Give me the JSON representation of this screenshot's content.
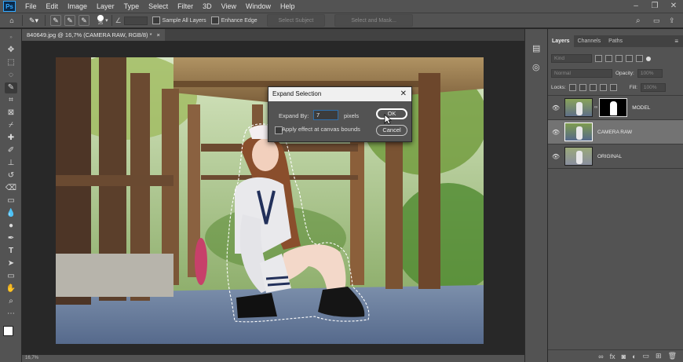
{
  "menubar": {
    "logo": "Ps",
    "items": [
      "File",
      "Edit",
      "Image",
      "Layer",
      "Type",
      "Select",
      "Filter",
      "3D",
      "View",
      "Window",
      "Help"
    ]
  },
  "options": {
    "brush_size": "25",
    "sample_all_layers": "Sample All Layers",
    "enhance_edge": "Enhance Edge",
    "select_subject": "Select Subject",
    "select_and_mask": "Select and Mask..."
  },
  "document": {
    "tab_title": "840649.jpg @ 16,7% (CAMERA RAW, RGB/8) *",
    "tab_close": "×"
  },
  "dialog": {
    "title": "Expand Selection",
    "expand_label": "Expand By:",
    "expand_value": "7",
    "unit": "pixels",
    "apply_bounds": "Apply effect at canvas bounds",
    "ok": "OK",
    "cancel": "Cancel"
  },
  "layers_panel": {
    "tabs": [
      "Layers",
      "Channels",
      "Paths"
    ],
    "kind_placeholder": "Kind",
    "blend_mode": "Normal",
    "opacity_label": "Opacity:",
    "opacity_value": "100%",
    "lock_label": "Locks:",
    "fill_label": "Fill:",
    "fill_value": "100%",
    "layers": [
      {
        "name": "MODEL",
        "selected": false,
        "has_mask": true
      },
      {
        "name": "CAMERA RAW",
        "selected": true,
        "has_mask": false
      },
      {
        "name": "ORIGINAL",
        "selected": false,
        "has_mask": false
      }
    ]
  },
  "status": {
    "zoom": "16,7%"
  },
  "colors": {
    "accent": "#31a8ff",
    "panel": "#535353",
    "dark": "#282828",
    "selected_layer": "#737373"
  }
}
